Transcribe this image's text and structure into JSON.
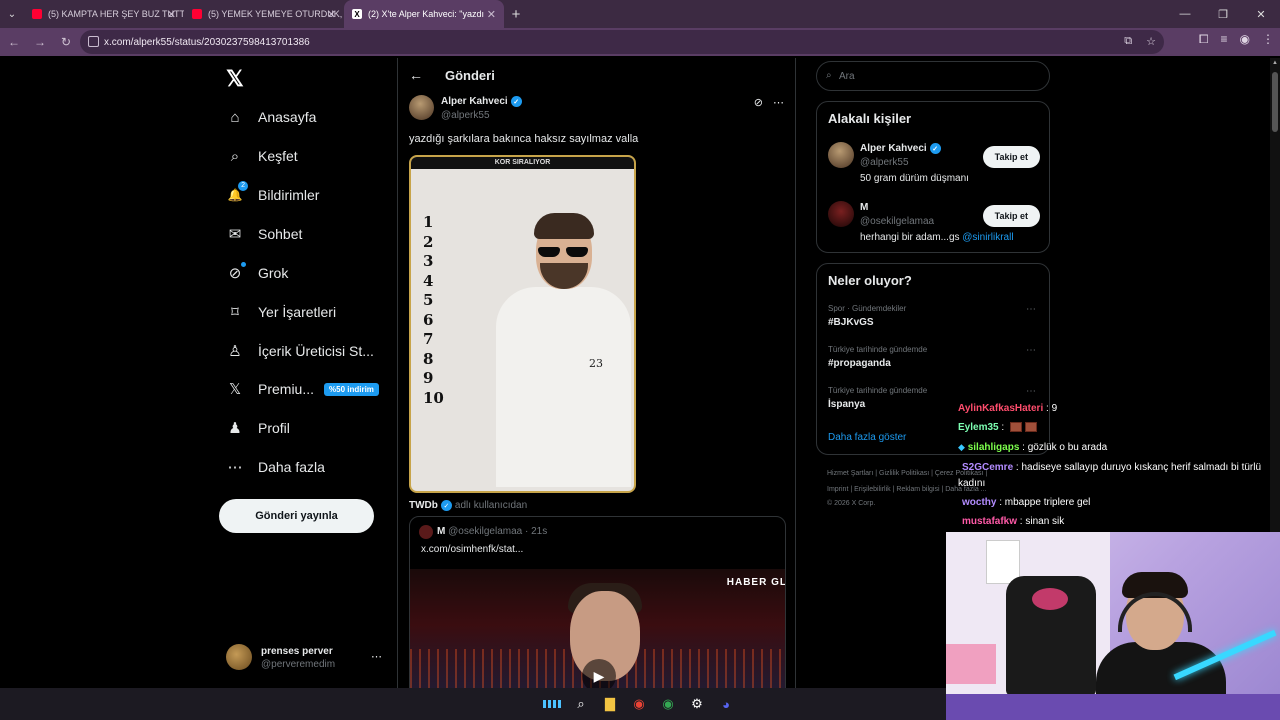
{
  "browser": {
    "tabs": [
      {
        "title": "(5) KAMPTA HER ŞEY BUZ TUTT",
        "type": "yt"
      },
      {
        "title": "(5) YEMEK YEMEYE OTURDUK, A",
        "type": "yt"
      },
      {
        "title": "(2) X'te Alper Kahveci: \"yazdı",
        "type": "x"
      }
    ],
    "url": "x.com/alperk55/status/2030237598413701386"
  },
  "nav": {
    "logo": "𝕏",
    "items": [
      {
        "label": "Anasayfa",
        "icon": "⌂"
      },
      {
        "label": "Keşfet",
        "icon": "⌕"
      },
      {
        "label": "Bildirimler",
        "icon": "🔔",
        "badge": "2"
      },
      {
        "label": "Sohbet",
        "icon": "✉"
      },
      {
        "label": "Grok",
        "icon": "⊘"
      },
      {
        "label": "Yer İşaretleri",
        "icon": "⌑"
      },
      {
        "label": "İçerik Üreticisi St...",
        "icon": "♙"
      },
      {
        "label": "Premiu...",
        "icon": "𝕏",
        "discount": "%50 indirim"
      },
      {
        "label": "Profil",
        "icon": "♟"
      },
      {
        "label": "Daha fazla",
        "icon": "⋯"
      }
    ],
    "post_button": "Gönderi yayınla",
    "account": {
      "name": "prenses perver",
      "handle": "@perveremedim"
    }
  },
  "post": {
    "page_title": "Gönderi",
    "author_name": "Alper Kahveci",
    "author_handle": "@alperk55",
    "text": "yazdığı şarkılara bakınca haksız sayılmaz valla",
    "image": {
      "header": "KOR SIRALIYOR",
      "numbers": [
        "1",
        "2",
        "3",
        "4",
        "5",
        "6",
        "7",
        "8",
        "9",
        "10"
      ],
      "jersey": "23"
    },
    "via_name": "TWDb",
    "via_suffix": "adlı kullanıcıdan",
    "quote": {
      "name": "M",
      "handle": "@osekilgelamaa",
      "time": "· 21s",
      "text": "x.com/osimhenfk/stat...",
      "video_label": "HABER GL"
    }
  },
  "right": {
    "search_placeholder": "Ara",
    "relevant_title": "Alakalı kişiler",
    "people": [
      {
        "name": "Alper Kahveci",
        "handle": "@alperk55",
        "bio": "50 gram dürüm düşmanı",
        "mention": "",
        "button": "Takip et"
      },
      {
        "name": "M",
        "handle": "@osekilgelamaa",
        "bio": "herhangi bir adam...gs ",
        "mention": "@sinirlikrall",
        "button": "Takip et"
      }
    ],
    "trends_title": "Neler oluyor?",
    "trends": [
      {
        "category": "Spor · Gündemdekiler",
        "title": "#BJKvGS"
      },
      {
        "category": "Türkiye tarihinde gündemde",
        "title": "#propaganda"
      },
      {
        "category": "Türkiye tarihinde gündemde",
        "title": "İspanya"
      }
    ],
    "show_more": "Daha fazla göster",
    "footer_line1": "Hizmet Şartları  |  Gizlilik Politikası  |  Çerez Politikası  |",
    "footer_line2": "Imprint  |  Erişilebilirlik  |  Reklam bilgisi  |  Daha fazla ...",
    "footer_line3": "© 2026 X Corp."
  },
  "chat": [
    {
      "user": "AylinKafkasHateri",
      "color": "#ff4d6d",
      "text": " : 9",
      "badge": false
    },
    {
      "user": "Eylem35",
      "color": "#7dffb2",
      "text": " : ",
      "emotes": 2,
      "badge": false
    },
    {
      "user": "silahligaps",
      "color": "#7dff4d",
      "text": " : gözlük o bu arada",
      "badge": true
    },
    {
      "user": "S2GCemre",
      "color": "#b38cff",
      "text": " : hadiseye sallayıp duruyo kıskanç herif salmadı bi türlü",
      "badge": false
    },
    {
      "user": "",
      "color": "#fff",
      "text": "kadını",
      "badge": false
    },
    {
      "user": "wocthy",
      "color": "#b38cff",
      "text": " : mbappe triplere gel",
      "badge": false
    },
    {
      "user": "mustafafkw",
      "color": "#ff5aa8",
      "text": " : sinan sik",
      "badge": false
    }
  ]
}
